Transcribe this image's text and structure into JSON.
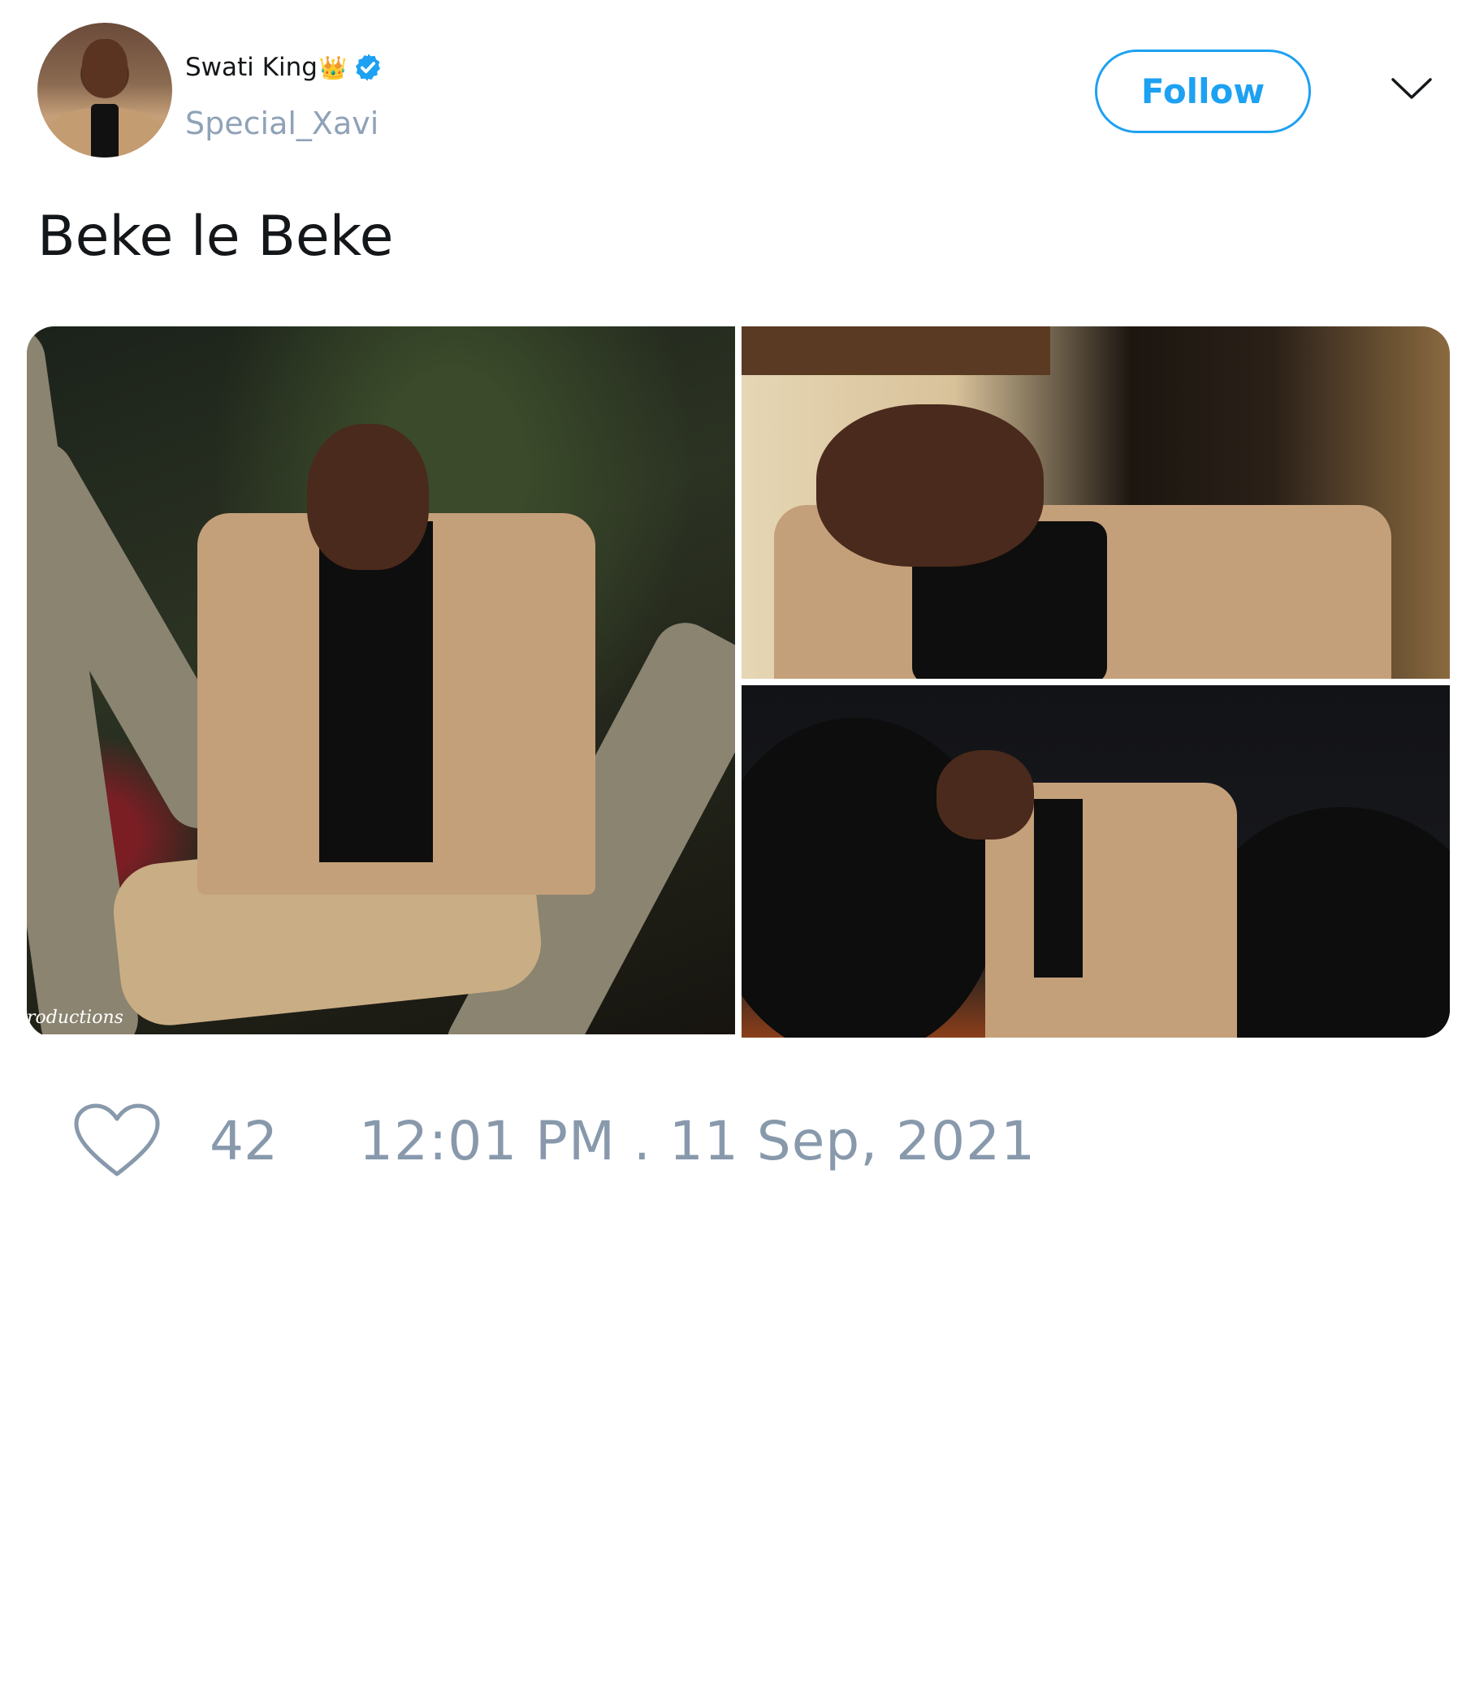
{
  "user": {
    "display_name": "Swati King",
    "crown_emoji": "👑",
    "handle": "Special_Xavi",
    "verified": true
  },
  "header": {
    "follow_label": "Follow",
    "menu_icon": "chevron-down-icon"
  },
  "tweet": {
    "text": "Beke le Beke",
    "media_count": 3,
    "watermark_text": "roductions"
  },
  "footer": {
    "like_icon": "heart-icon",
    "like_count": "42",
    "timestamp": "12:01 PM . 11 Sep, 2021"
  },
  "colors": {
    "accent": "#1da1f2",
    "muted": "#8899ac",
    "text": "#14171a"
  }
}
